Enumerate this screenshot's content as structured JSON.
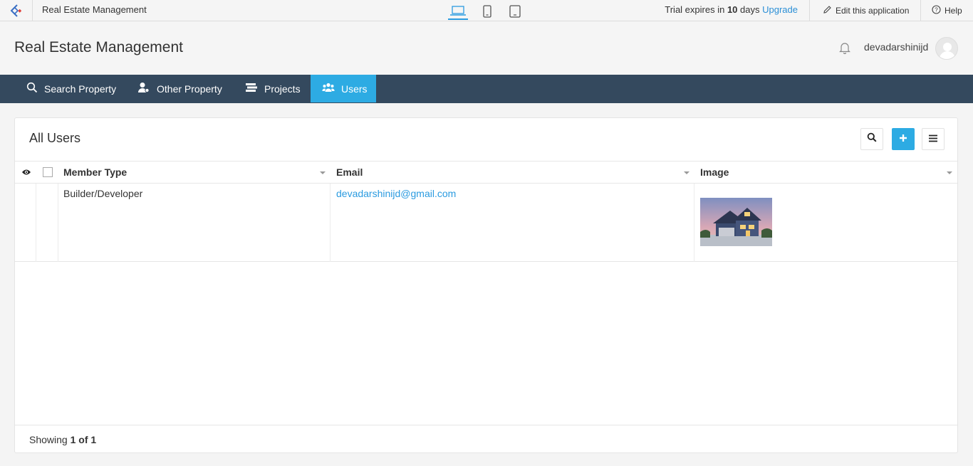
{
  "topbar": {
    "app_name": "Real Estate Management",
    "devices": [
      "laptop-icon",
      "phone-icon",
      "tablet-icon"
    ],
    "trial_prefix": "Trial expires in",
    "trial_days": "10",
    "trial_suffix": "days",
    "upgrade_label": "Upgrade",
    "edit_label": "Edit this application",
    "help_label": "Help"
  },
  "header": {
    "title": "Real Estate Management",
    "username": "devadarshinijd"
  },
  "nav": {
    "items": [
      {
        "label": "Search Property",
        "icon": "search-icon"
      },
      {
        "label": "Other Property",
        "icon": "user-icon"
      },
      {
        "label": "Projects",
        "icon": "projects-icon"
      },
      {
        "label": "Users",
        "icon": "users-icon",
        "active": true
      }
    ]
  },
  "panel": {
    "title": "All Users",
    "columns": [
      "Member Type",
      "Email",
      "Image"
    ],
    "rows": [
      {
        "member_type": "Builder/Developer",
        "email": "devadarshinijd@gmail.com",
        "image": "house-photo"
      }
    ],
    "footer_prefix": "Showing",
    "footer_count": "1 of 1"
  },
  "colors": {
    "nav_bg": "#34495e",
    "accent": "#2dabe3",
    "link": "#2b9be0"
  }
}
